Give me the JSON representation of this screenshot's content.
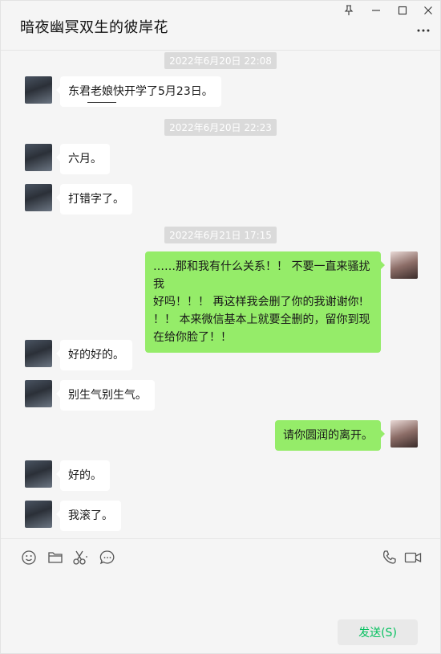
{
  "window": {
    "title": "暗夜幽冥双生的彼岸花"
  },
  "messages": [
    {
      "type": "time",
      "text": "2022年6月20日 22:08"
    },
    {
      "type": "msg",
      "side": "left",
      "text": "东君老娘快开学了5月23日。"
    },
    {
      "type": "time",
      "text": "2022年6月20日 22:23"
    },
    {
      "type": "msg",
      "side": "left",
      "text": "六月。"
    },
    {
      "type": "msg",
      "side": "left",
      "text": "打错字了。"
    },
    {
      "type": "time",
      "text": "2022年6月21日 17:15"
    },
    {
      "type": "msg",
      "side": "right",
      "lines": [
        "……那和我有什么关系！！ 不要一直来骚扰我",
        "好吗！！！ 再这样我会删了你的我谢谢你!",
        "！！ 本来微信基本上就要全删的，留你到现",
        "在给你脸了！！"
      ]
    },
    {
      "type": "msg",
      "side": "left",
      "text": "好的好的。"
    },
    {
      "type": "msg",
      "side": "left",
      "text": "别生气别生气。"
    },
    {
      "type": "msg",
      "side": "right",
      "text": "请你圆润的离开。"
    },
    {
      "type": "msg",
      "side": "left",
      "text": "好的。"
    },
    {
      "type": "msg",
      "side": "left",
      "text": "我滚了。"
    }
  ],
  "toolbar": {
    "icons": [
      "emoji-icon",
      "folder-icon",
      "scissors-icon",
      "chat-history-icon",
      "phone-icon",
      "video-icon"
    ]
  },
  "composer": {
    "send_label": "发送(S)"
  },
  "colors": {
    "self_bubble": "#95ec69",
    "other_bubble": "#ffffff",
    "send_text": "#07c160"
  }
}
